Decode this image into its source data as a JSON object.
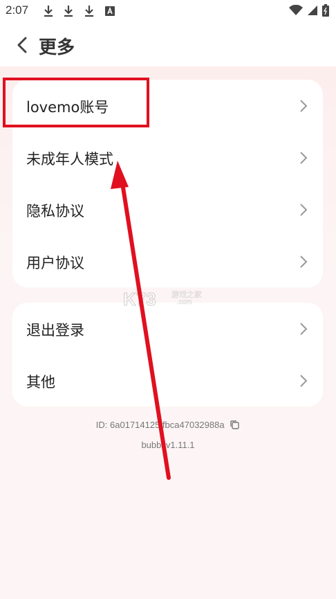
{
  "status_bar": {
    "time": "2:07",
    "icons": [
      "download-icon",
      "download-icon",
      "download-icon",
      "text-a-icon",
      "wifi-icon",
      "signal-icon",
      "battery-icon"
    ]
  },
  "header": {
    "title": "更多",
    "back_icon": "chevron-left-icon"
  },
  "menu_group_1": [
    {
      "label": "lovemo账号"
    },
    {
      "label": "未成年人模式"
    },
    {
      "label": "隐私协议"
    },
    {
      "label": "用户协议"
    }
  ],
  "menu_group_2": [
    {
      "label": "退出登录"
    },
    {
      "label": "其他"
    }
  ],
  "footer": {
    "id_text": "ID: 6a01714125 fbca47032988a",
    "version": "bubbl v1.11.1"
  },
  "watermark": {
    "logo": "K73",
    "text": "游戏之家",
    "sub": ".com"
  },
  "colors": {
    "annotation": "#e01020",
    "background": "#fdf3f3",
    "card": "#ffffff"
  }
}
